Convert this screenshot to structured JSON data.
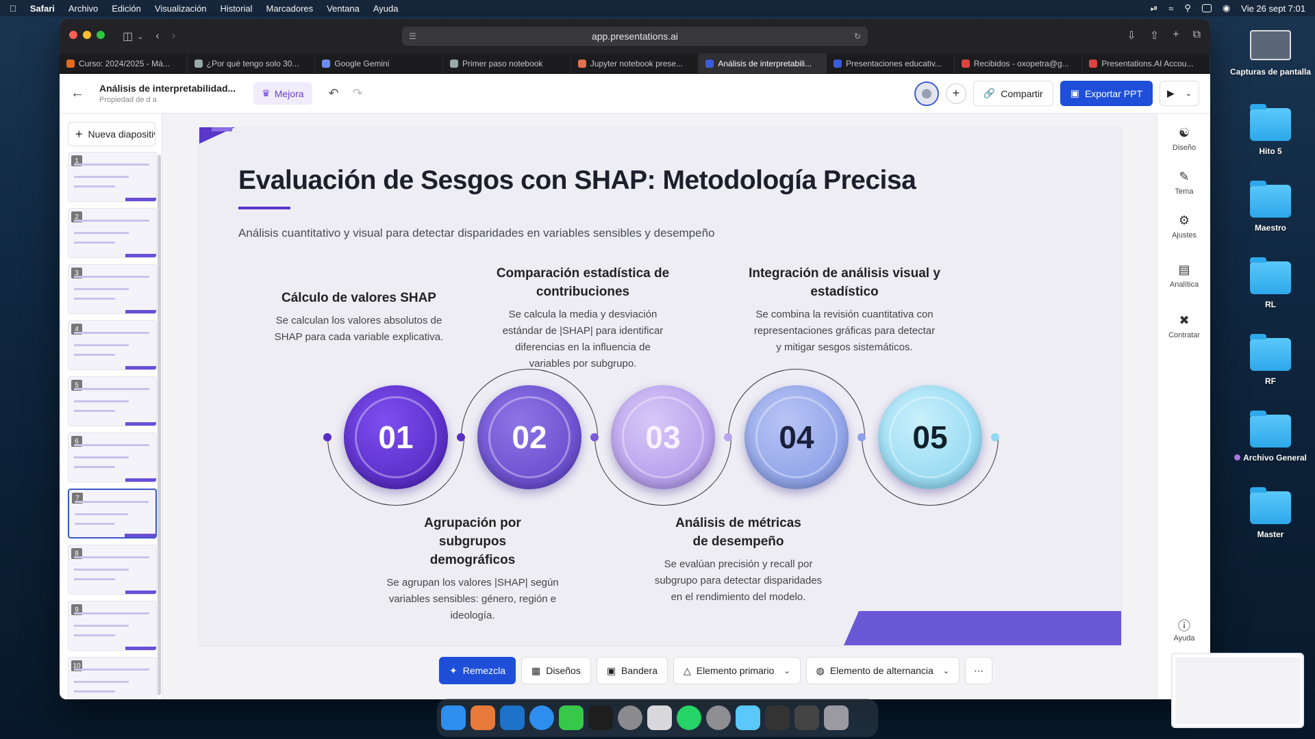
{
  "menubar": {
    "app": "Safari",
    "items": [
      "Archivo",
      "Edición",
      "Visualización",
      "Historial",
      "Marcadores",
      "Ventana",
      "Ayuda"
    ],
    "clock": "Vie 26 sept 7:01"
  },
  "browser": {
    "url": "app.presentations.ai",
    "tabs": [
      {
        "label": "Curso: 2024/2025 - Má...",
        "color": "#e66a1e"
      },
      {
        "label": "¿Por qué tengo solo 30...",
        "color": "#9aa"
      },
      {
        "label": "Google Gemini",
        "color": "#6d8cf0"
      },
      {
        "label": "Primer paso notebook",
        "color": "#9aa"
      },
      {
        "label": "Jupyter notebook prese...",
        "color": "#e07050"
      },
      {
        "label": "Análisis de interpretabili...",
        "color": "#3b5bd9"
      },
      {
        "label": "Presentaciones educativ...",
        "color": "#3b5bd9"
      },
      {
        "label": "Recibidos - oxopetra@g...",
        "color": "#d44"
      },
      {
        "label": "Presentations.AI Accou...",
        "color": "#d44"
      }
    ]
  },
  "app": {
    "doc_title": "Análisis de interpretabilidad...",
    "doc_sub": "Propiedad de d a",
    "mejora": "Mejora",
    "share": "Compartir",
    "export": "Exportar PPT",
    "new_slide": "Nueva diapositiva"
  },
  "slide": {
    "title": "Evaluación de Sesgos con SHAP: Metodología Precisa",
    "subtitle": "Análisis cuantitativo y visual para detectar disparidades en variables sensibles y desempeño",
    "steps": [
      {
        "num": "01",
        "title": "Cálculo de valores SHAP",
        "text": "Se calculan los valores absolutos de SHAP para cada variable explicativa.",
        "color": "#5a2ec4"
      },
      {
        "num": "02",
        "title": "Agrupación por subgrupos demográficos",
        "text": "Se agrupan los valores |SHAP| según variables sensibles: género, región e ideología.",
        "color": "#6a4fd0"
      },
      {
        "num": "03",
        "title": "Comparación estadística de contribuciones",
        "text": "Se calcula la media y desviación estándar de |SHAP| para identificar diferencias en la influencia de variables por subgrupo.",
        "color": "#b9a3ee"
      },
      {
        "num": "04",
        "title": "Análisis de métricas de desempeño",
        "text": "Se evalúan precisión y recall por subgrupo para detectar disparidades en el rendimiento del modelo.",
        "color": "#8ea2ea"
      },
      {
        "num": "05",
        "title": "Integración de análisis visual y estadístico",
        "text": "Se combina la revisión cuantitativa con representaciones gráficas para detectar y mitigar sesgos sistemáticos.",
        "color": "#8fd9f2"
      }
    ]
  },
  "thumbnails": [
    "1",
    "2",
    "3",
    "4",
    "5",
    "6",
    "7",
    "8",
    "9",
    "10"
  ],
  "rightpanel": [
    "Diseño",
    "Tema",
    "Ajustes",
    "Analítica",
    "Contratar",
    "Ayuda"
  ],
  "bottombar": [
    "Remezcla",
    "Diseños",
    "Bandera",
    "Elemento primario",
    "Elemento de alternancia"
  ],
  "desktop": [
    "Capturas de pantalla",
    "Hito 5",
    "Maestro",
    "RL",
    "RF",
    "Archivo General",
    "Master"
  ]
}
